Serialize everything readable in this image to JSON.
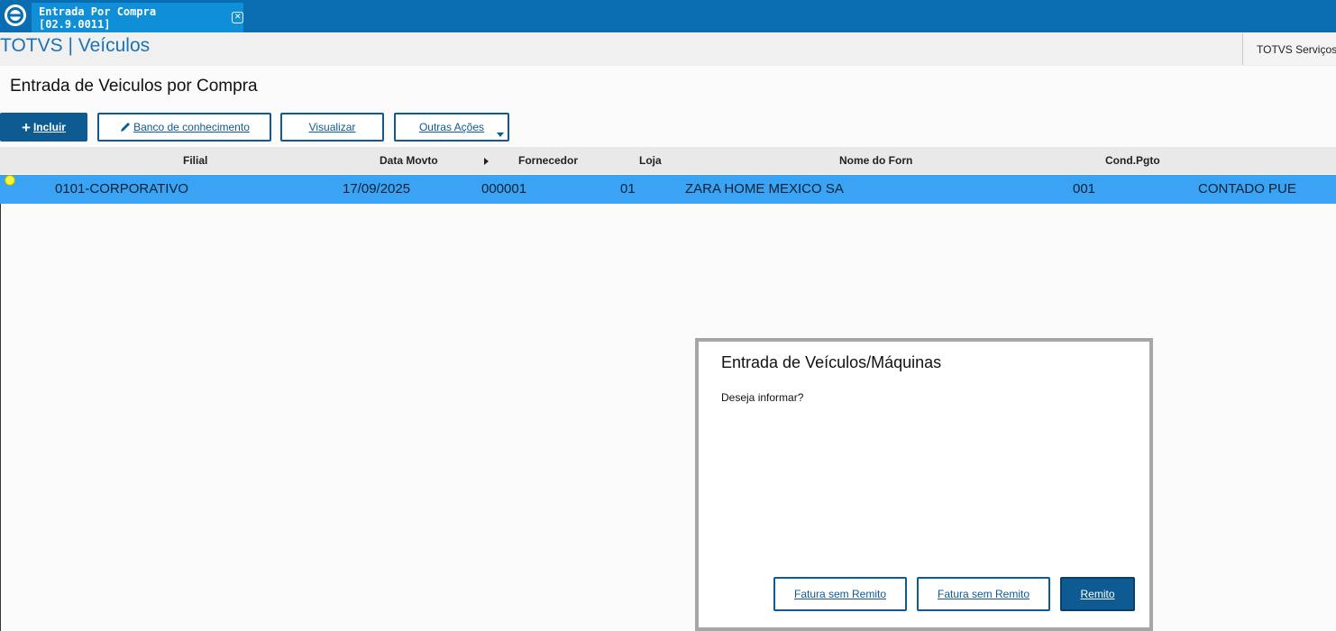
{
  "tab": {
    "title": "Entrada Por Compra [02.9.0011]"
  },
  "header": {
    "app_name": "TOTVS | Veículos",
    "company": "TOTVS Serviços"
  },
  "page": {
    "title": "Entrada de Veiculos por Compra"
  },
  "toolbar": {
    "include_label": "Incluir",
    "knowledge_label": "Banco de conhecimento",
    "view_label": "Visualizar",
    "other_label": "Outras Ações"
  },
  "grid": {
    "columns": [
      "Filial",
      "Data Movto",
      "Fornecedor",
      "Loja",
      "Nome do Forn",
      "Cond.Pgto"
    ],
    "rows": [
      {
        "filial": "0101-CORPORATIVO",
        "data": "17/09/2025",
        "fornecedor": "000001",
        "loja": "01",
        "nome": "ZARA HOME MEXICO SA",
        "cond": "001",
        "extra": "CONTADO PUE"
      }
    ]
  },
  "dialog": {
    "title": "Entrada de Veículos/Máquinas",
    "message": "Deseja informar?",
    "buttons": [
      "Fatura sem Remito",
      "Fatura sem Remito",
      "Remito"
    ]
  },
  "colors": {
    "topbar": "#0b6db1",
    "accent": "#0e5a93",
    "selected_row": "#3aa3f3"
  }
}
